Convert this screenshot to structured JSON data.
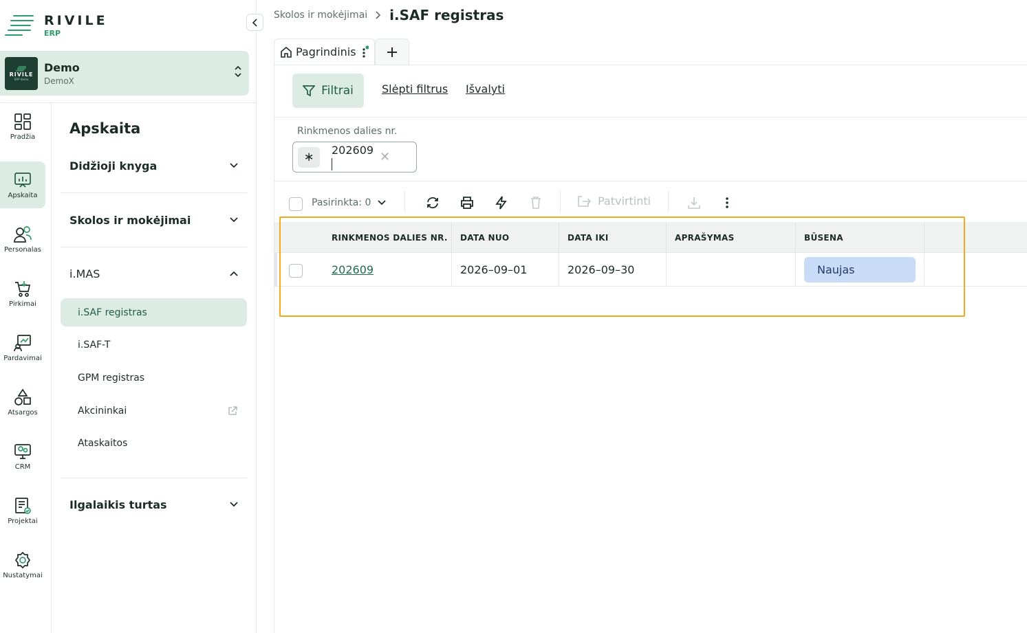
{
  "brand": {
    "word": "RIVILE",
    "sub": "ERP",
    "accent": "#2e9c6a"
  },
  "company": {
    "logo_word": "RIVILE",
    "logo_sub": "ERP demo",
    "name": "Demo",
    "sub": "DemoX"
  },
  "rail": [
    {
      "label": "Pradžia",
      "icon": "dashboard-icon"
    },
    {
      "label": "Apskaita",
      "icon": "chart-board-icon",
      "active": true
    },
    {
      "label": "Personalas",
      "icon": "people-icon"
    },
    {
      "label": "Pirkimai",
      "icon": "cart-icon"
    },
    {
      "label": "Pardavimai",
      "icon": "sales-icon"
    },
    {
      "label": "Atsargos",
      "icon": "shapes-icon"
    },
    {
      "label": "CRM",
      "icon": "crm-icon"
    },
    {
      "label": "Projektai",
      "icon": "projects-icon"
    },
    {
      "label": "Nustatymai",
      "icon": "gear-icon"
    }
  ],
  "menu": {
    "title": "Apskaita",
    "groups": [
      {
        "label": "Didžioji knyga",
        "expanded": false
      },
      {
        "label": "Skolos ir mokėjimai",
        "expanded": false
      },
      {
        "label": "i.MAS",
        "expanded": true
      },
      {
        "label": "Ilgalaikis turtas",
        "expanded": false
      }
    ],
    "imas_items": [
      {
        "label": "i.SAF registras",
        "active": true
      },
      {
        "label": "i.SAF-T"
      },
      {
        "label": "GPM registras"
      },
      {
        "label": "Akcininkai",
        "external": true
      },
      {
        "label": "Ataskaitos"
      }
    ]
  },
  "breadcrumb": {
    "parent": "Skolos ir mokėjimai",
    "current": "i.SAF registras"
  },
  "tabs": [
    {
      "label": "Pagrindinis"
    }
  ],
  "filters": {
    "button": "Filtrai",
    "hide": "Slėpti filtrus",
    "clear": "Išvalyti",
    "field_label": "Rinkmenos dalies nr.",
    "field_operator": "∗",
    "field_value": "202609"
  },
  "toolbar": {
    "selected": "Pasirinkta: 0",
    "confirm": "Patvirtinti"
  },
  "grid": {
    "columns": [
      "RINKMENOS DALIES NR.",
      "DATA NUO",
      "DATA IKI",
      "APRAŠYMAS",
      "BŪSENA"
    ],
    "rows": [
      {
        "nr": "202609",
        "from": "2026–09–01",
        "to": "2026–09–30",
        "desc": "",
        "status": "Naujas"
      }
    ]
  },
  "colors": {
    "active_bg": "#dcebe4",
    "highlight": "#f2a91e",
    "status_bg": "#c9dcf7"
  }
}
